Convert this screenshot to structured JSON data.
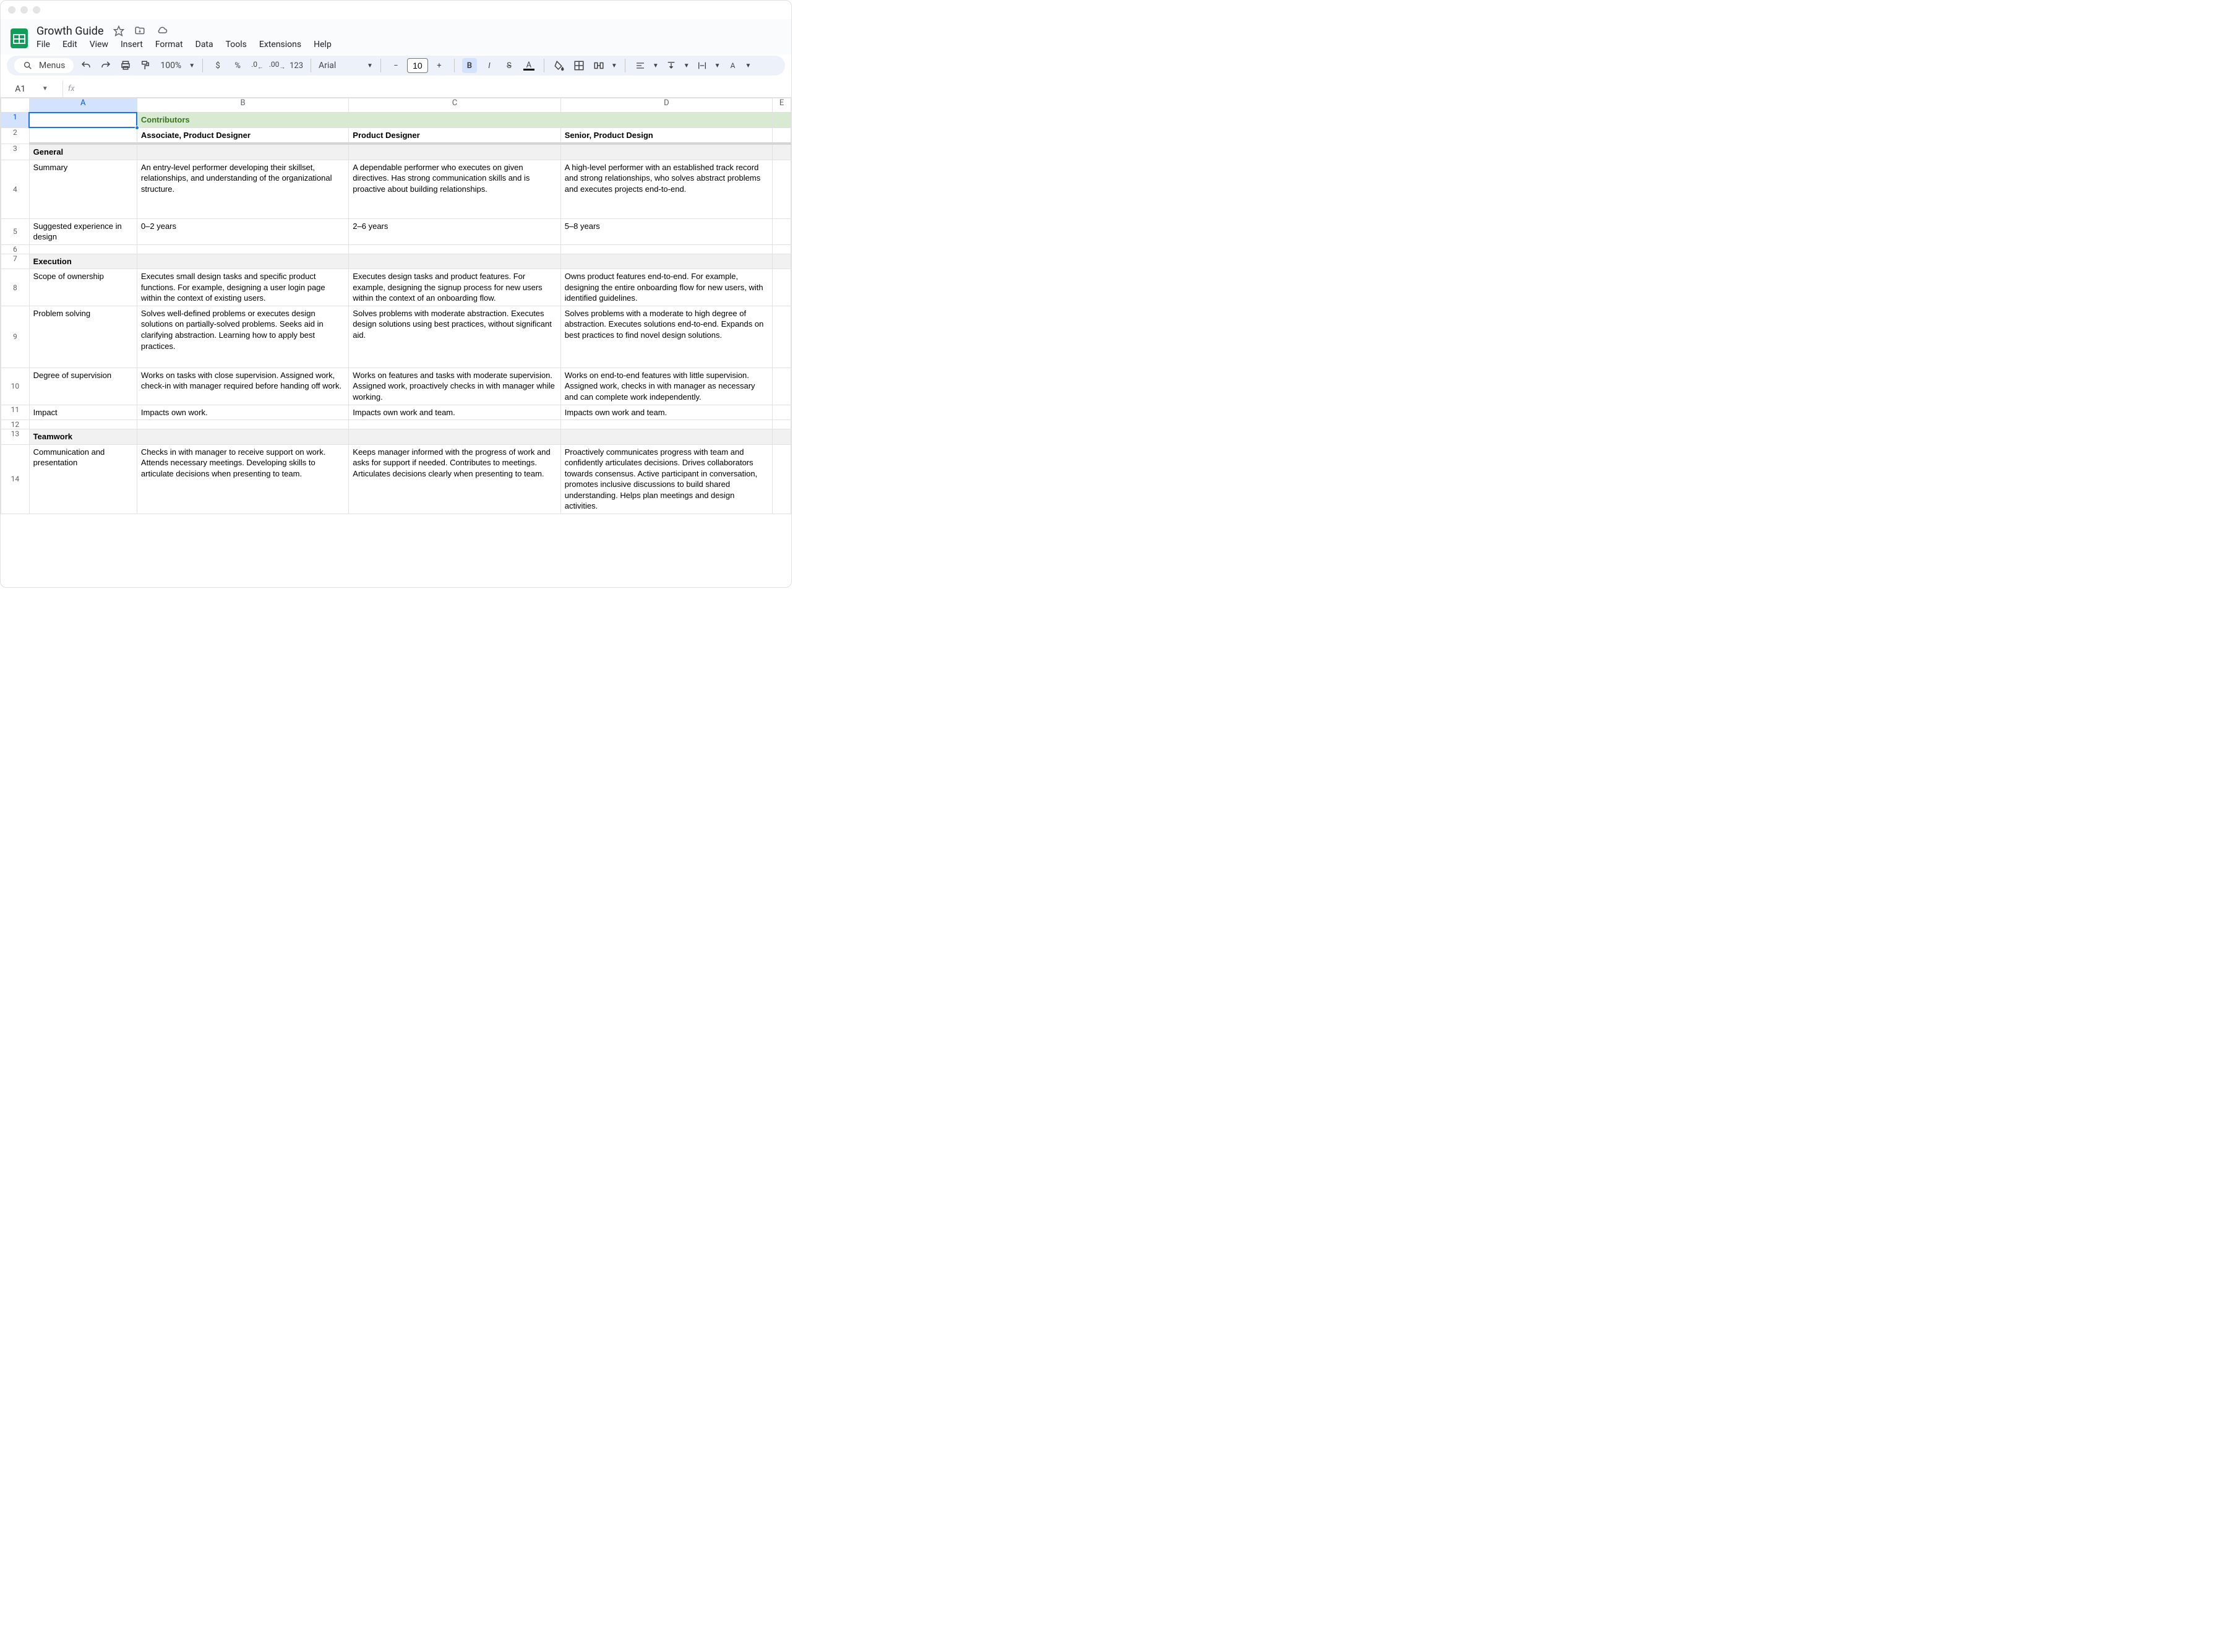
{
  "doc": {
    "title": "Growth Guide"
  },
  "menus": {
    "file": "File",
    "edit": "Edit",
    "view": "View",
    "insert": "Insert",
    "format": "Format",
    "data": "Data",
    "tools": "Tools",
    "extensions": "Extensions",
    "help": "Help"
  },
  "toolbar": {
    "menus_label": "Menus",
    "zoom": "100%",
    "font": "Arial",
    "font_size": "10",
    "number_label": "123"
  },
  "namebox": {
    "cell": "A1"
  },
  "columns": [
    "A",
    "B",
    "C",
    "D",
    "E"
  ],
  "grid": {
    "r1": {
      "b": "Contributors"
    },
    "r2": {
      "b": "Associate, Product Designer",
      "c": "Product Designer",
      "d": "Senior, Product Design"
    },
    "r3": {
      "a": "General"
    },
    "r4": {
      "a": "Summary",
      "b": "An entry-level performer developing their skillset, relationships, and understanding of the organizational structure.",
      "c": "A dependable performer who executes on given directives. Has strong communication skills and is proactive about building relationships.",
      "d": "A high-level performer with an established track record and strong relationships, who solves abstract problems and executes projects end-to-end."
    },
    "r5": {
      "a": "Suggested experience in design",
      "b": "0–2 years",
      "c": "2–6 years",
      "d": "5–8 years"
    },
    "r7": {
      "a": "Execution"
    },
    "r8": {
      "a": "Scope of ownership",
      "b": "Executes small design tasks and specific product functions. For example, designing a user login page within the context of existing users.",
      "c": "Executes design tasks and product features. For example, designing the signup process for new users within the context of an onboarding flow.",
      "d": "Owns product features end-to-end. For example, designing the entire onboarding flow for new users, with identified guidelines."
    },
    "r9": {
      "a": "Problem solving",
      "b": "Solves well-defined problems or executes design solutions on partially-solved problems. Seeks aid in clarifying abstraction. Learning how to apply best practices.",
      "c": "Solves problems with moderate abstraction. Executes design solutions using best practices, without significant aid.",
      "d": "Solves problems with a moderate to high degree of abstraction. Executes solutions end-to-end. Expands on best practices to find novel design solutions."
    },
    "r10": {
      "a": "Degree of supervision",
      "b": "Works on tasks with close supervision. Assigned work, check-in with manager required before handing off work.",
      "c": "Works on features and tasks with moderate supervision. Assigned work, proactively checks in with manager while working.",
      "d": "Works on end-to-end features with little supervision. Assigned work, checks in with manager as necessary and can complete work independently."
    },
    "r11": {
      "a": "Impact",
      "b": "Impacts own work.",
      "c": "Impacts own work and team.",
      "d": "Impacts own work and team."
    },
    "r13": {
      "a": "Teamwork"
    },
    "r14": {
      "a": "Communication and presentation",
      "b": "Checks in with manager to receive support on work. Attends necessary meetings. Developing skills to articulate decisions when presenting to team.",
      "c": "Keeps manager informed with the progress of work and asks for support if needed. Contributes to meetings. Articulates decisions clearly when presenting to team.",
      "d": "Proactively communicates progress with team and confidently articulates decisions. Drives collaborators towards consensus. Active participant in conversation, promotes inclusive discussions to build shared understanding. Helps plan meetings and design activities."
    }
  }
}
